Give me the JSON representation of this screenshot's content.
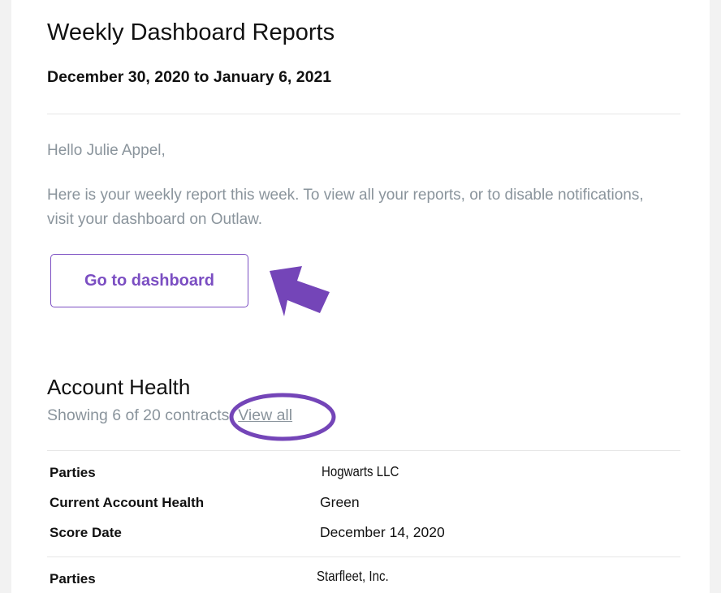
{
  "header": {
    "title": "Weekly Dashboard Reports",
    "date_range": "December 30, 2020 to January 6, 2021"
  },
  "body": {
    "greeting": "Hello Julie Appel,",
    "intro": "Here is your weekly report this week. To view all your reports, or to disable notifications, visit your dashboard on Outlaw.",
    "dashboard_button": "Go to dashboard"
  },
  "account_health": {
    "title": "Account Health",
    "showing_text": "Showing 6 of 20 contracts.",
    "view_all": "View all",
    "contracts": [
      {
        "parties_label": "Parties",
        "parties": "Hogwarts LLC",
        "health_label": "Current Account Health",
        "health": "Green",
        "score_date_label": "Score Date",
        "score_date": "December 14, 2020"
      },
      {
        "parties_label": "Parties",
        "parties": "Starfleet, Inc."
      }
    ]
  },
  "colors": {
    "accent": "#7b4ec2",
    "annotation": "#7445b8",
    "muted_text": "#8a949c"
  },
  "icons": {
    "arrow": "arrow-annotation-icon",
    "circle": "circle-annotation-icon"
  }
}
